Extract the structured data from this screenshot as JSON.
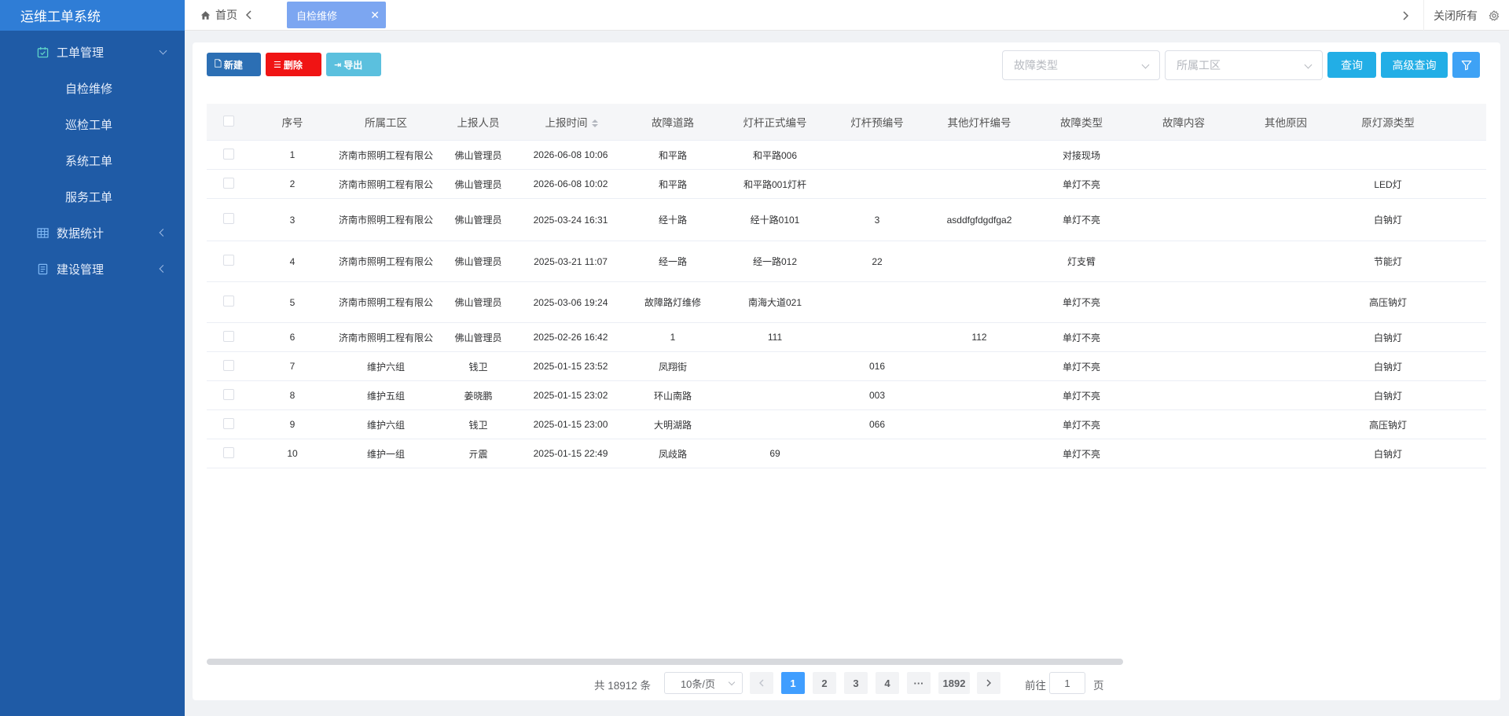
{
  "app": {
    "title": "运维工单系统"
  },
  "sidebar": {
    "groups": [
      {
        "label": "工单管理",
        "icon": "calendar-check-icon",
        "expanded": true
      },
      {
        "label": "数据统计",
        "icon": "grid-table-icon",
        "expanded": false
      },
      {
        "label": "建设管理",
        "icon": "document-icon",
        "expanded": false
      }
    ],
    "sub_items": [
      "自检维修",
      "巡检工单",
      "系统工单",
      "服务工单"
    ]
  },
  "topbar": {
    "home_label": "首页",
    "active_tab": "自检维修",
    "close_all": "关闭所有"
  },
  "toolbar": {
    "new_label": "新建",
    "delete_label": "删除",
    "export_label": "导出"
  },
  "filters": {
    "fault_type_placeholder": "故障类型",
    "district_placeholder": "所属工区",
    "query_label": "查询",
    "advanced_label": "高级查询"
  },
  "table": {
    "columns": [
      "序号",
      "所属工区",
      "上报人员",
      "上报时间",
      "故障道路",
      "灯杆正式编号",
      "灯杆预编号",
      "其他灯杆编号",
      "故障类型",
      "故障内容",
      "其他原因",
      "原灯源类型"
    ],
    "sortable_column": 3,
    "rows": [
      [
        "1",
        "济南市照明工程有限公",
        "佛山管理员",
        "2026-06-08 10:06",
        "和平路",
        "和平路006",
        "",
        "",
        "对接现场",
        "",
        "",
        ""
      ],
      [
        "2",
        "济南市照明工程有限公",
        "佛山管理员",
        "2026-06-08 10:02",
        "和平路",
        "和平路001灯杆",
        "",
        "",
        "单灯不亮",
        "",
        "",
        "LED灯"
      ],
      [
        "3",
        "济南市照明工程有限公",
        "佛山管理员",
        "2025-03-24 16:31",
        "经十路",
        "经十路0101",
        "3",
        "asddfgfdgdfga2",
        "单灯不亮",
        "",
        "",
        "白钠灯"
      ],
      [
        "4",
        "济南市照明工程有限公",
        "佛山管理员",
        "2025-03-21 11:07",
        "经一路",
        "经一路012",
        "22",
        "",
        "灯支臂",
        "",
        "",
        "节能灯"
      ],
      [
        "5",
        "济南市照明工程有限公",
        "佛山管理员",
        "2025-03-06 19:24",
        "故障路灯维修",
        "南海大道021",
        "",
        "",
        "单灯不亮",
        "",
        "",
        "高压钠灯"
      ],
      [
        "6",
        "济南市照明工程有限公",
        "佛山管理员",
        "2025-02-26 16:42",
        "1",
        "111",
        "",
        "112",
        "单灯不亮",
        "",
        "",
        "白钠灯"
      ],
      [
        "7",
        "维护六组",
        "钱卫",
        "2025-01-15 23:52",
        "凤翔街",
        "",
        "016",
        "",
        "单灯不亮",
        "",
        "",
        "白钠灯"
      ],
      [
        "8",
        "维护五组",
        "姜晓鹏",
        "2025-01-15 23:02",
        "环山南路",
        "",
        "003",
        "",
        "单灯不亮",
        "",
        "",
        "白钠灯"
      ],
      [
        "9",
        "维护六组",
        "钱卫",
        "2025-01-15 23:00",
        "大明湖路",
        "",
        "066",
        "",
        "单灯不亮",
        "",
        "",
        "高压钠灯"
      ],
      [
        "10",
        "维护一组",
        "亓震",
        "2025-01-15 22:49",
        "凤歧路",
        "69",
        "",
        "",
        "单灯不亮",
        "",
        "",
        "白钠灯"
      ]
    ]
  },
  "pagination": {
    "total": "共 18912 条",
    "page_size": "10条/页",
    "pages": [
      "1",
      "2",
      "3",
      "4",
      "···",
      "1892"
    ],
    "current": "1",
    "goto_prefix": "前往",
    "goto_value": "1",
    "goto_suffix": "页"
  },
  "colors": {
    "sidebar_bg": "#1f5ba6",
    "brand_bg": "#2f7dd6",
    "tab_active": "#7ca6f1",
    "btn_new": "#2c6fb4",
    "btn_delete": "#f01414",
    "btn_export": "#5bc0de",
    "btn_query": "#22aee6",
    "page_active": "#409eff"
  }
}
